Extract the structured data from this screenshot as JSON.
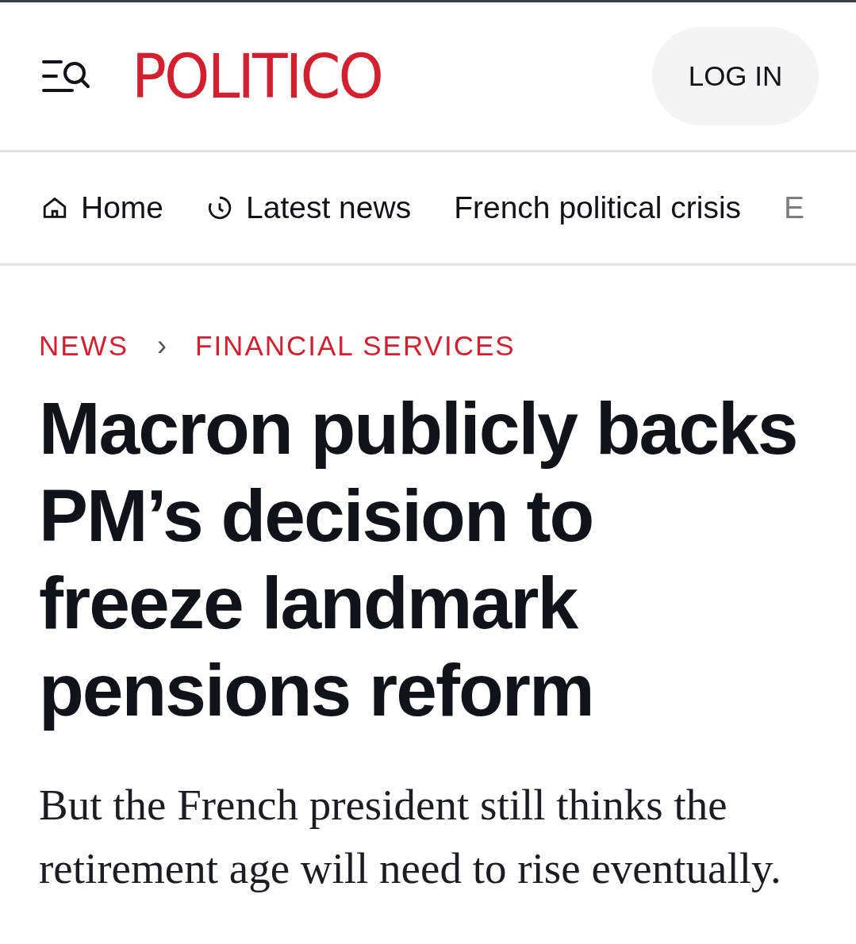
{
  "header": {
    "logo": "POLITICO",
    "login_button": "LOG IN"
  },
  "nav": [
    {
      "label": "Home",
      "kind": "home"
    },
    {
      "label": "Latest news",
      "kind": "clock"
    },
    {
      "label": "French political crisis",
      "kind": "text"
    },
    {
      "label": "E",
      "kind": "text"
    }
  ],
  "breadcrumb": [
    "NEWS",
    "FINANCIAL SERVICES"
  ],
  "breadcrumb_separator": "›",
  "headline": "Macron publicly backs PM’s decision to freeze landmark pensions reform",
  "deck": "But the French president still thinks the retirement age will need to rise eventually."
}
